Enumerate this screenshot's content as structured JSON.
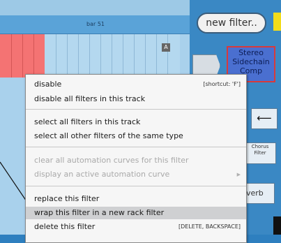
{
  "timeline": {
    "bar_label": "bar 51",
    "marker_letter": "A"
  },
  "toolbar": {
    "new_filter_label": "new filter.."
  },
  "filters": {
    "stereo_label_1": "Stereo",
    "stereo_label_2": "Sidechain",
    "stereo_label_3": "Comp",
    "chorus_label_1": "Chorus",
    "chorus_label_2": "Filter",
    "reverb_label": "verb",
    "arrow_glyph": "⟵"
  },
  "menu": {
    "items": [
      {
        "label": "disable",
        "shortcut": "[shortcut: 'F']",
        "enabled": true
      },
      {
        "label": "disable all filters in this track",
        "enabled": true
      },
      {
        "label": "select all filters in this track",
        "enabled": true
      },
      {
        "label": "select all other filters of the same type",
        "enabled": true
      },
      {
        "label": "clear all automation curves for this filter",
        "enabled": false
      },
      {
        "label": "display an active automation curve",
        "enabled": false,
        "submenu_arrow": "▶"
      },
      {
        "label": "replace this filter",
        "enabled": true
      },
      {
        "label": "wrap this filter in a new rack filter",
        "enabled": true,
        "highlighted": true
      },
      {
        "label": "delete this filter",
        "shortcut": "[DELETE, BACKSPACE]",
        "enabled": true
      }
    ]
  },
  "colors": {
    "background": "#2e7fbf",
    "track_red": "#f47373",
    "stereo_node": "#4a6fd0",
    "menu_bg": "#f6f6f6",
    "menu_highlight": "#cfd0d2",
    "disabled_text": "#a9a9a9"
  }
}
